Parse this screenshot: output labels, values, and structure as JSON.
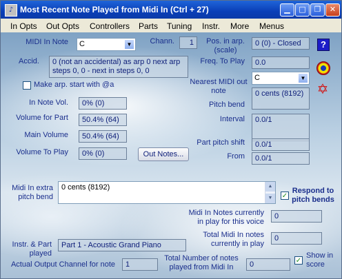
{
  "window": {
    "title": "Most Recent Note Played from Midi In (Ctrl + 27)",
    "app_icon": "note-icon"
  },
  "menu": [
    "In Opts",
    "Out Opts",
    "Controllers",
    "Parts",
    "Tuning",
    "Instr.",
    "More",
    "Menus"
  ],
  "fields": {
    "midi_in_note_label": "MIDI In Note",
    "midi_in_note_value": "C",
    "chann_label": "Chann.",
    "chann_value": "1",
    "pos_in_arp_label": "Pos. in arp. (scale)",
    "pos_in_arp_value": "0 (0) - Closed",
    "accid_label": "Accid.",
    "accid_value": "0 (not an accidental) as arp 0 next arp steps 0, 0 - next in steps 0, 0",
    "freq_label": "Freq. To Play",
    "freq_value": "0.0",
    "make_arp_label": "Make arp. start with @a",
    "nearest_midi_label": "Nearest MIDI out note",
    "nearest_midi_value": "C",
    "cents_value": "0 cents (8192)",
    "pitch_bend_label": "Pitch bend",
    "in_note_vol_label": "In Note Vol.",
    "in_note_vol_value": "0%  (0)",
    "vol_part_label": "Volume for Part",
    "vol_part_value": "50.4%  (64)",
    "interval_label": "Interval",
    "interval_value": "0.0/1",
    "main_vol_label": "Main Volume",
    "main_vol_value": "50.4%  (64)",
    "part_pitch_label": "Part pitch shift",
    "part_pitch_value": "0.0/1",
    "vol_play_label": "Volume To Play",
    "vol_play_value": "0%  (0)",
    "out_notes_button": "Out Notes...",
    "from_label": "From",
    "from_value": "0.0/1",
    "midi_extra_label": "Midi In extra pitch bend",
    "midi_extra_value": "0 cents (8192)",
    "respond_label": "Respond to pitch bends",
    "in_play_voice_label": "Midi In Notes currently in play for this voice",
    "in_play_voice_value": "0",
    "total_in_play_label": "Total Midi In notes currently in play",
    "total_in_play_value": "0",
    "instr_part_label": "Instr. & Part played",
    "instr_part_value": "Part 1 - Acoustic Grand Piano",
    "actual_out_label": "Actual Output Channel for note",
    "actual_out_value": "1",
    "total_played_label": "Total Number of notes played from Midi In",
    "total_played_value": "0",
    "show_score_label": "Show in score"
  },
  "checks": {
    "make_arp": false,
    "respond": true,
    "show_score": true
  },
  "colors": {
    "label": "#1a2e8c",
    "titlebar": "#0a3fb8"
  }
}
